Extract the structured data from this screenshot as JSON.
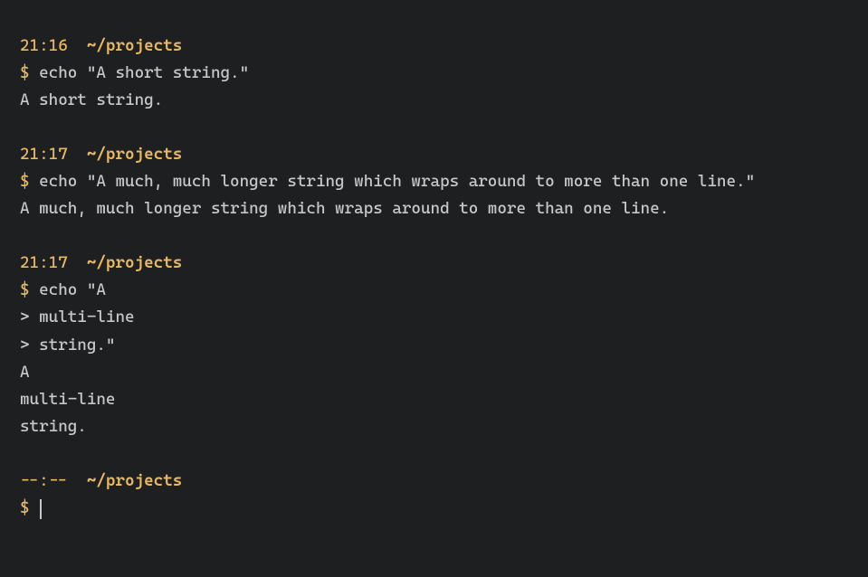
{
  "blocks": [
    {
      "time": "21:16",
      "path": "~/projects",
      "prompt": "$",
      "command": "echo \"A short string.\"",
      "continuations": [],
      "output": [
        "A short string."
      ]
    },
    {
      "time": "21:17",
      "path": "~/projects",
      "prompt": "$",
      "command": "echo \"A much, much longer string which wraps around to more than one line.\"",
      "continuations": [],
      "output": [
        "A much, much longer string which wraps around to more than one line."
      ]
    },
    {
      "time": "21:17",
      "path": "~/projects",
      "prompt": "$",
      "command": "echo \"A",
      "continuations": [
        "multi-line",
        "string.\""
      ],
      "output": [
        "A",
        "multi-line",
        "string."
      ]
    }
  ],
  "current": {
    "time": "--:--",
    "path": "~/projects",
    "prompt": "$"
  },
  "cont_prompt": ">"
}
